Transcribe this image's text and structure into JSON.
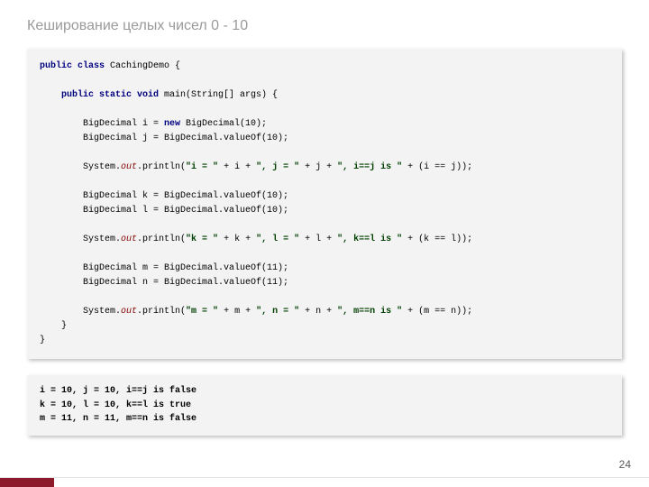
{
  "title": "Кеширование целых чисел 0 - 10",
  "code": {
    "l1a": "public class",
    "l1b": " CachingDemo {",
    "l2a": "    public static void",
    "l2b": " main(String[] args) {",
    "l3a": "        BigDecimal i = ",
    "l3b": "new",
    "l3c": " BigDecimal(10);",
    "l4": "        BigDecimal j = BigDecimal.valueOf(10);",
    "l5a": "        System.",
    "l5b": "out",
    "l5c": ".println(",
    "l5d": "\"i = \"",
    "l5e": " + i + ",
    "l5f": "\", j = \"",
    "l5g": " + j + ",
    "l5h": "\", i==j is \"",
    "l5i": " + (i == j));",
    "l6": "        BigDecimal k = BigDecimal.valueOf(10);",
    "l7": "        BigDecimal l = BigDecimal.valueOf(10);",
    "l8a": "        System.",
    "l8b": "out",
    "l8c": ".println(",
    "l8d": "\"k = \"",
    "l8e": " + k + ",
    "l8f": "\", l = \"",
    "l8g": " + l + ",
    "l8h": "\", k==l is \"",
    "l8i": " + (k == l));",
    "l9": "        BigDecimal m = BigDecimal.valueOf(11);",
    "l10": "        BigDecimal n = BigDecimal.valueOf(11);",
    "l11a": "        System.",
    "l11b": "out",
    "l11c": ".println(",
    "l11d": "\"m = \"",
    "l11e": " + m + ",
    "l11f": "\", n = \"",
    "l11g": " + n + ",
    "l11h": "\", m==n is \"",
    "l11i": " + (m == n));",
    "l12": "    }",
    "l13": "}"
  },
  "output": "i = 10, j = 10, i==j is false\nk = 10, l = 10, k==l is true\nm = 11, n = 11, m==n is false",
  "page_number": "24"
}
